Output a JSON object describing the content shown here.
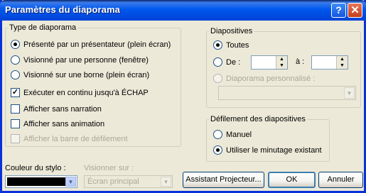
{
  "window": {
    "title": "Paramètres du diaporama",
    "help_glyph": "?",
    "close_glyph": "✕"
  },
  "type_group": {
    "legend": "Type de diaporama",
    "options": [
      {
        "label": "Présenté par un présentateur (plein écran)",
        "selected": true
      },
      {
        "label": "Visionné par une personne (fenêtre)",
        "selected": false
      },
      {
        "label": "Visionné sur une borne (plein écran)",
        "selected": false
      }
    ],
    "checkboxes": [
      {
        "label": "Exécuter en continu jusqu'à ÉCHAP",
        "checked": true,
        "enabled": true
      },
      {
        "label": "Afficher sans narration",
        "checked": false,
        "enabled": true
      },
      {
        "label": "Afficher sans animation",
        "checked": false,
        "enabled": true
      },
      {
        "label": "Afficher la barre de défilement",
        "checked": false,
        "enabled": false
      }
    ]
  },
  "slides_group": {
    "legend": "Diapositives",
    "all_label": "Toutes",
    "from_label": "De :",
    "to_label": "à :",
    "from_value": "",
    "to_value": "",
    "custom_label": "Diaporama personnalisé :",
    "custom_value": ""
  },
  "advance_group": {
    "legend": "Défilement des diapositives",
    "manual_label": "Manuel",
    "timing_label": "Utiliser le minutage existant"
  },
  "pen": {
    "label": "Couleur du stylo :",
    "color": "#000000"
  },
  "monitor": {
    "label": "Visionner sur :",
    "value": "Écran principal"
  },
  "buttons": {
    "wizard": "Assistant Projecteur...",
    "ok": "OK",
    "cancel": "Annuler"
  },
  "colors": {
    "title_bar": "#0058ee",
    "dialog_bg": "#ece9d8",
    "disabled_text": "#aca899"
  },
  "arrow_up": "▲",
  "arrow_down": "▼"
}
